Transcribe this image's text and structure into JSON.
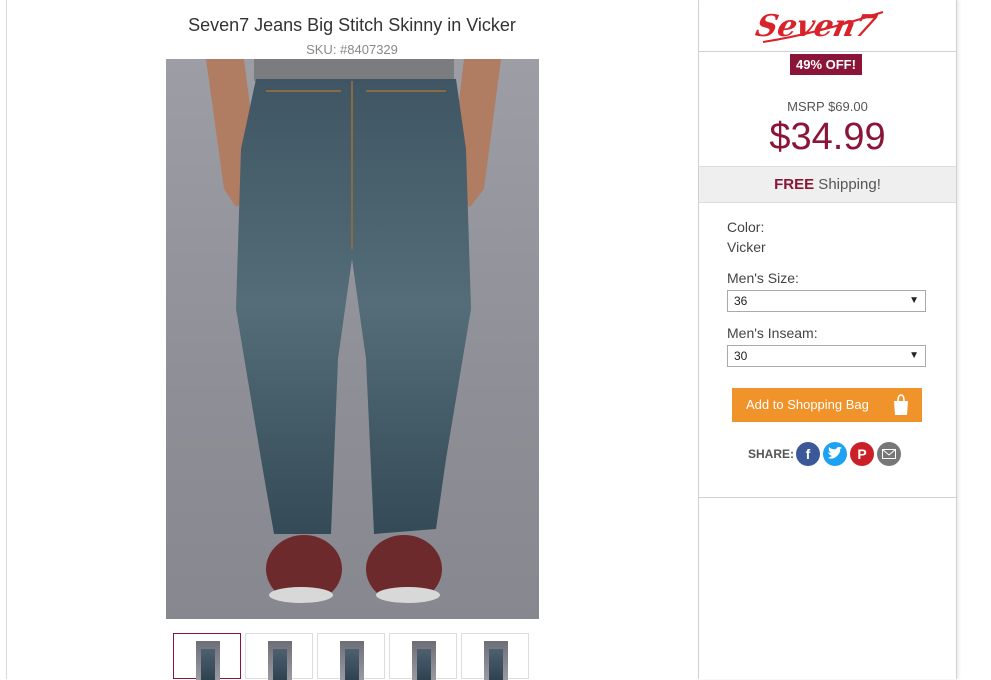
{
  "product": {
    "title": "Seven7 Jeans Big Stitch Skinny in Vicker",
    "sku": "SKU: #8407329"
  },
  "brand": {
    "logo_text": "Seven7",
    "color": "#d8232a"
  },
  "pricing": {
    "discount_badge": "49% OFF!",
    "msrp": "MSRP $69.00",
    "price": "$34.99",
    "accent": "#8a1538"
  },
  "shipping": {
    "free": "FREE",
    "label": " Shipping!"
  },
  "options": {
    "color_label": "Color:",
    "color_value": "Vicker",
    "size_label": "Men's Size:",
    "size_value": "36",
    "inseam_label": "Men's Inseam:",
    "inseam_value": "30"
  },
  "cart": {
    "add_label": "Add to Shopping Bag",
    "button_color": "#f0932b"
  },
  "share": {
    "label": "SHARE:",
    "icons": [
      "facebook-icon",
      "twitter-icon",
      "pinterest-icon",
      "email-icon"
    ]
  },
  "thumbnails": [
    "thumbnail-1",
    "thumbnail-2",
    "thumbnail-3",
    "thumbnail-4",
    "thumbnail-5"
  ]
}
